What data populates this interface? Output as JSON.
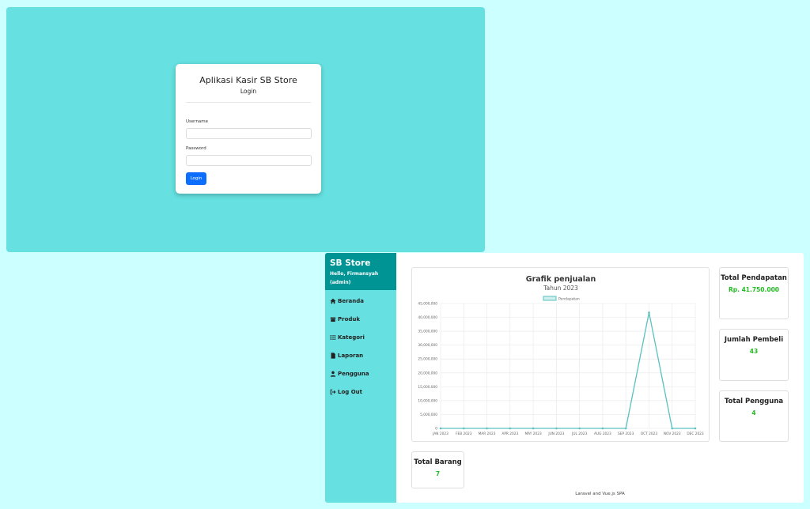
{
  "login": {
    "title": "Aplikasi Kasir SB Store",
    "subtitle": "Login",
    "username_label": "Username",
    "username_value": "",
    "password_label": "Password",
    "password_value": "",
    "button_label": "Login"
  },
  "sidebar": {
    "brand": "SB Store",
    "greeting": "Hello, Firmansyah (admin)",
    "items": [
      {
        "label": "Beranda",
        "icon": "home-icon"
      },
      {
        "label": "Produk",
        "icon": "box-icon"
      },
      {
        "label": "Kategori",
        "icon": "list-icon"
      },
      {
        "label": "Laporan",
        "icon": "file-icon"
      },
      {
        "label": "Pengguna",
        "icon": "user-icon"
      },
      {
        "label": "Log Out",
        "icon": "logout-icon"
      }
    ]
  },
  "chart_data": {
    "type": "line",
    "title": "Grafik penjualan",
    "subtitle": "Tahun 2023",
    "categories": [
      "JAN 2023",
      "FEB 2023",
      "MAR 2023",
      "APR 2023",
      "MAY 2023",
      "JUN 2023",
      "JUL 2023",
      "AUG 2023",
      "SEP 2023",
      "OCT 2023",
      "NOV 2023",
      "DEC 2023"
    ],
    "series": [
      {
        "name": "Pendapatan",
        "values": [
          0,
          0,
          0,
          0,
          0,
          0,
          0,
          0,
          0,
          41750000,
          0,
          0
        ],
        "color": "#5bc0c0"
      }
    ],
    "yticks": [
      "0",
      "5,000,000",
      "10,000,000",
      "15,000,000",
      "20,000,000",
      "25,000,000",
      "30,000,000",
      "35,000,000",
      "40,000,000",
      "45,000,000"
    ],
    "ylim": [
      0,
      45000000
    ],
    "grid": true,
    "legend": "top"
  },
  "stats": {
    "total_pendapatan": {
      "label": "Total Pendapatan",
      "value": "Rp. 41.750.000"
    },
    "jumlah_pembeli": {
      "label": "Jumlah Pembeli",
      "value": "43"
    },
    "total_pengguna": {
      "label": "Total Pengguna",
      "value": "4"
    },
    "total_barang": {
      "label": "Total Barang",
      "value": "7"
    }
  },
  "footer": "Laravel and Vue.js SPA",
  "colors": {
    "accent": "#66e0e0",
    "header": "#009494",
    "primary_button": "#0d6efd",
    "value_green": "#22bb22"
  }
}
